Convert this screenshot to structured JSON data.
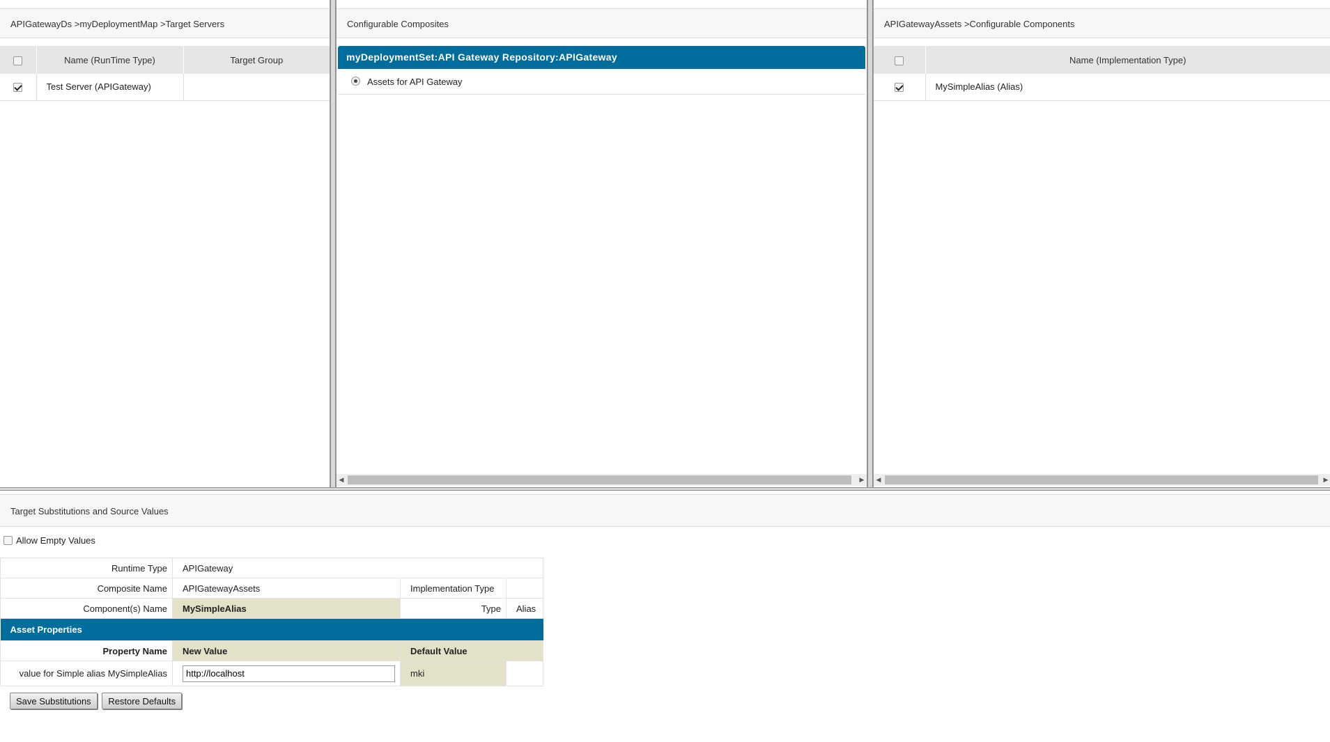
{
  "left": {
    "breadcrumb": "APIGatewayDs >myDeploymentMap >Target Servers",
    "columns": [
      "",
      "Name (RunTime Type)",
      "Target Group"
    ],
    "rows": [
      {
        "checked": true,
        "name": "Test Server (APIGateway)",
        "target_group": ""
      }
    ]
  },
  "middle": {
    "title": "Configurable Composites",
    "composite_header": "myDeploymentSet:API Gateway Repository:APIGateway",
    "items": [
      {
        "selected": true,
        "label": "Assets for API Gateway"
      }
    ]
  },
  "right": {
    "breadcrumb": "APIGatewayAssets >Configurable Components",
    "columns": [
      "",
      "Name (Implementation Type)"
    ],
    "rows": [
      {
        "checked": true,
        "name": "MySimpleAlias (Alias)"
      }
    ]
  },
  "bottom": {
    "title": "Target Substitutions and Source Values",
    "allow_empty_label": "Allow Empty Values",
    "allow_empty_checked": false,
    "runtime_type_label": "Runtime Type",
    "runtime_type_value": "APIGateway",
    "composite_name_label": "Composite Name",
    "composite_name_value": "APIGatewayAssets",
    "impl_type_label": "Implementation Type",
    "impl_type_value": "",
    "components_label": "Component(s) Name",
    "components_value": "MySimpleAlias",
    "type_label": "Type",
    "type_value": "Alias",
    "section_title": "Asset Properties",
    "col_property": "Property Name",
    "col_new_value": "New Value",
    "col_default_value": "Default Value",
    "property_name": "value for Simple alias MySimpleAlias",
    "new_value": "http://localhost",
    "default_value": "mki",
    "save_label": "Save Substitutions",
    "restore_label": "Restore Defaults"
  },
  "colors": {
    "accent": "#016d9c",
    "highlight": "#e3e1c8",
    "header_bg": "#e6e6e6"
  }
}
